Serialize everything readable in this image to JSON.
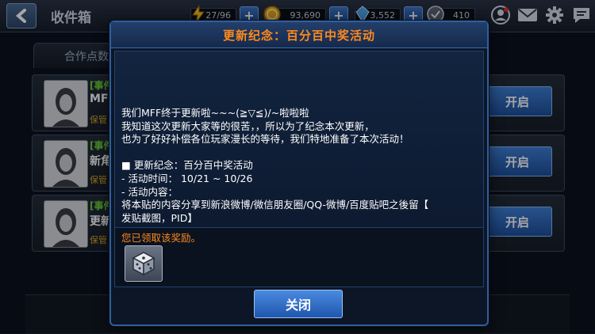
{
  "header": {
    "title": "收件箱",
    "energy": "27/96",
    "gold": "93,690",
    "crystals": "3,552",
    "points": "410"
  },
  "tabs": {
    "coop_label": "合作点数"
  },
  "mail_rows": [
    {
      "tag": "[事件",
      "name": "MF",
      "keep": "保管",
      "button": "开启"
    },
    {
      "tag": "[事件",
      "name": "新角",
      "keep": "保管",
      "button": "开启"
    },
    {
      "tag": "[事件",
      "name": "更新",
      "keep": "保管",
      "button": "开启"
    }
  ],
  "modal": {
    "title": "更新纪念：百分百中奖活动",
    "message": "我们MFF终于更新啦~~~(≧▽≦)/~啦啦啦\n我知道这次更新大家等的很苦，，所以为了纪念本次更新，\n也为了好好补偿各位玩家漫长的等待，我们特地准备了本次活动！\n\n■ 更新纪念：百分百中奖活动\n- 活动时间： 10/21 ~ 10/26\n- 活动内容：\n将本贴的内容分享到新浪微博/微信朋友圈/QQ-微博/百度贴吧之後留【\n发贴截图，PID】",
    "reward_note": "您已领取该奖励。",
    "reward_item_icon": "dice-icon",
    "close_label": "关闭"
  },
  "colors": {
    "accent_orange": "#ff8a1c",
    "button_blue": "#2f6cc2",
    "tag_green": "#6fcf3d"
  }
}
